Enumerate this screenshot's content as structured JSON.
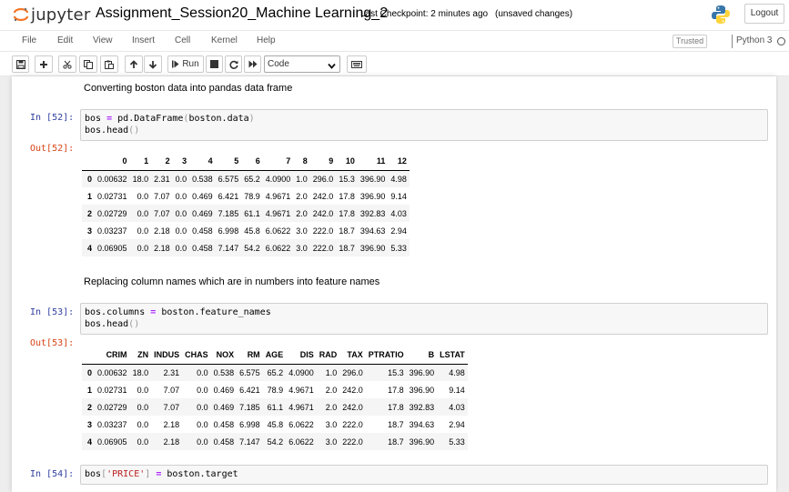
{
  "header": {
    "logo_text": "jupyter",
    "notebook_name": "Assignment_Session20_Machine Learning_2",
    "checkpoint": "Last Checkpoint: 2 minutes ago",
    "save_status": "(unsaved changes)",
    "logout_label": "Logout"
  },
  "menu": {
    "items": [
      "File",
      "Edit",
      "View",
      "Insert",
      "Cell",
      "Kernel",
      "Help"
    ],
    "trusted_label": "Trusted",
    "kernel_name": "Python 3"
  },
  "toolbar": {
    "run_label": "Run",
    "cell_type": "Code",
    "icons": [
      "save-icon",
      "plus-icon",
      "scissors-icon",
      "copy-icon",
      "paste-icon",
      "arrow-up-icon",
      "arrow-down-icon",
      "step-forward-icon",
      "stop-icon",
      "restart-icon",
      "fast-forward-icon",
      "keyboard-icon"
    ]
  },
  "cells": {
    "md1": "Converting boston data into pandas data frame",
    "c52": {
      "in_prompt": "In [52]:",
      "out_prompt": "Out[52]:",
      "line1": {
        "a": "bos",
        "op": "=",
        "b": "pd.DataFrame",
        "p1": "(",
        "c": "boston.data",
        "p2": ")"
      },
      "line2": {
        "a": "bos.head",
        "p": "()"
      }
    },
    "md2": "Replacing column names which are in numbers into feature names",
    "c53": {
      "in_prompt": "In [53]:",
      "out_prompt": "Out[53]:",
      "line1": {
        "a": "bos.columns",
        "op": "=",
        "b": "boston.feature_names"
      },
      "line2": {
        "a": "bos.head",
        "p": "()"
      }
    },
    "c54": {
      "in_prompt": "In [54]:",
      "line1": {
        "a": "bos",
        "p1": "[",
        "s": "'PRICE'",
        "p2": "]",
        "op": "=",
        "b": "boston.target"
      }
    }
  },
  "table52": {
    "headers": [
      "",
      "0",
      "1",
      "2",
      "3",
      "4",
      "5",
      "6",
      "7",
      "8",
      "9",
      "10",
      "11",
      "12"
    ],
    "rows": [
      [
        "0",
        "0.00632",
        "18.0",
        "2.31",
        "0.0",
        "0.538",
        "6.575",
        "65.2",
        "4.0900",
        "1.0",
        "296.0",
        "15.3",
        "396.90",
        "4.98"
      ],
      [
        "1",
        "0.02731",
        "0.0",
        "7.07",
        "0.0",
        "0.469",
        "6.421",
        "78.9",
        "4.9671",
        "2.0",
        "242.0",
        "17.8",
        "396.90",
        "9.14"
      ],
      [
        "2",
        "0.02729",
        "0.0",
        "7.07",
        "0.0",
        "0.469",
        "7.185",
        "61.1",
        "4.9671",
        "2.0",
        "242.0",
        "17.8",
        "392.83",
        "4.03"
      ],
      [
        "3",
        "0.03237",
        "0.0",
        "2.18",
        "0.0",
        "0.458",
        "6.998",
        "45.8",
        "6.0622",
        "3.0",
        "222.0",
        "18.7",
        "394.63",
        "2.94"
      ],
      [
        "4",
        "0.06905",
        "0.0",
        "2.18",
        "0.0",
        "0.458",
        "7.147",
        "54.2",
        "6.0622",
        "3.0",
        "222.0",
        "18.7",
        "396.90",
        "5.33"
      ]
    ]
  },
  "table53": {
    "headers": [
      "",
      "CRIM",
      "ZN",
      "INDUS",
      "CHAS",
      "NOX",
      "RM",
      "AGE",
      "DIS",
      "RAD",
      "TAX",
      "PTRATIO",
      "B",
      "LSTAT"
    ],
    "rows": [
      [
        "0",
        "0.00632",
        "18.0",
        "2.31",
        "0.0",
        "0.538",
        "6.575",
        "65.2",
        "4.0900",
        "1.0",
        "296.0",
        "15.3",
        "396.90",
        "4.98"
      ],
      [
        "1",
        "0.02731",
        "0.0",
        "7.07",
        "0.0",
        "0.469",
        "6.421",
        "78.9",
        "4.9671",
        "2.0",
        "242.0",
        "17.8",
        "396.90",
        "9.14"
      ],
      [
        "2",
        "0.02729",
        "0.0",
        "7.07",
        "0.0",
        "0.469",
        "7.185",
        "61.1",
        "4.9671",
        "2.0",
        "242.0",
        "17.8",
        "392.83",
        "4.03"
      ],
      [
        "3",
        "0.03237",
        "0.0",
        "2.18",
        "0.0",
        "0.458",
        "6.998",
        "45.8",
        "6.0622",
        "3.0",
        "222.0",
        "18.7",
        "394.63",
        "2.94"
      ],
      [
        "4",
        "0.06905",
        "0.0",
        "2.18",
        "0.0",
        "0.458",
        "7.147",
        "54.2",
        "6.0622",
        "3.0",
        "222.0",
        "18.7",
        "396.90",
        "5.33"
      ]
    ]
  }
}
